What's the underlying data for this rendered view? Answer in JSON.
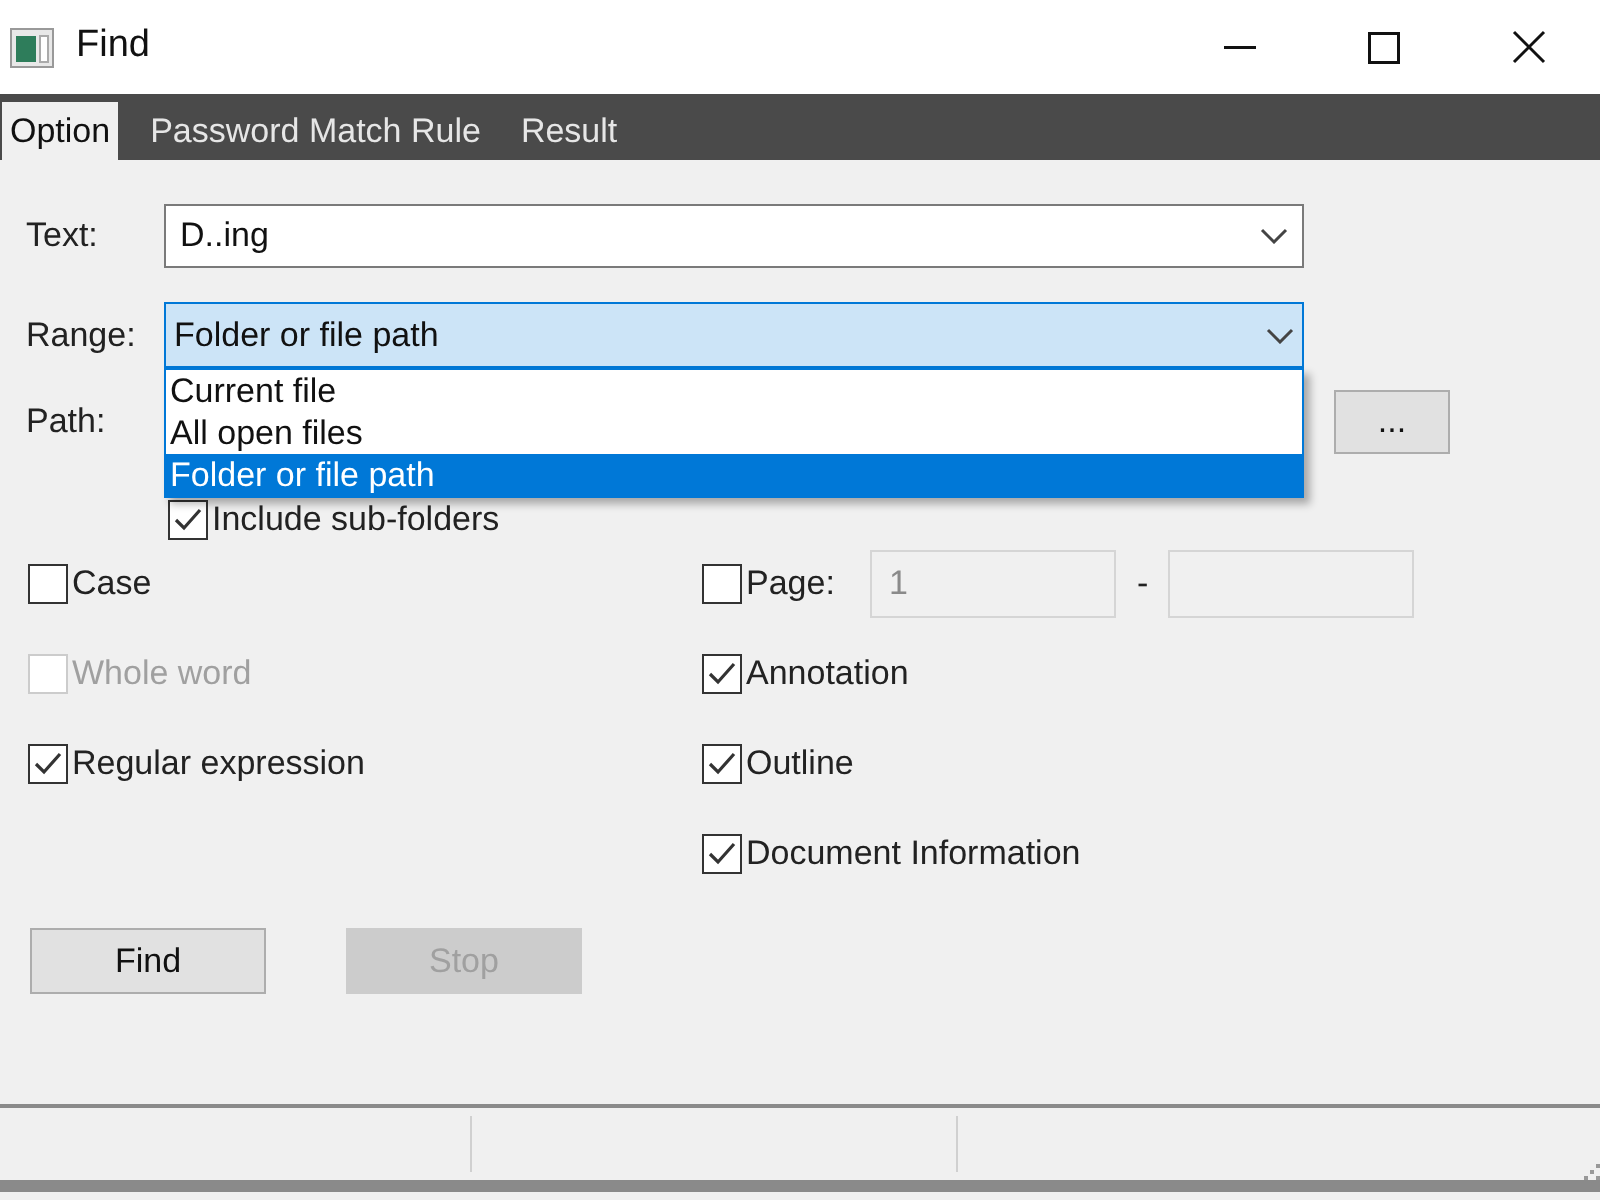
{
  "window": {
    "title": "Find"
  },
  "tabs": [
    {
      "label": "Option",
      "selected": true
    },
    {
      "label": "Password Match Rule",
      "selected": false
    },
    {
      "label": "Result",
      "selected": false
    }
  ],
  "text_field": {
    "label": "Text:",
    "value": "D..ing"
  },
  "range_field": {
    "label": "Range:",
    "value": "Folder or file path",
    "expanded": true,
    "options": [
      {
        "label": "Current file",
        "selected": false
      },
      {
        "label": "All open files",
        "selected": false
      },
      {
        "label": "Folder or file path",
        "selected": true
      }
    ]
  },
  "path": {
    "label": "Path:",
    "browse_button": "..."
  },
  "include_subfolders": {
    "label": "Include sub-folders",
    "checked": true
  },
  "options_left": [
    {
      "label": "Case",
      "checked": false,
      "disabled": false
    },
    {
      "label": "Whole word",
      "checked": false,
      "disabled": true
    },
    {
      "label": "Regular expression",
      "checked": true,
      "disabled": false
    }
  ],
  "page_option": {
    "label": "Page:",
    "checked": false,
    "from": "1",
    "separator": "-"
  },
  "options_right": [
    {
      "label": "Annotation",
      "checked": true,
      "disabled": false
    },
    {
      "label": "Outline",
      "checked": true,
      "disabled": false
    },
    {
      "label": "Document Information",
      "checked": true,
      "disabled": false
    }
  ],
  "buttons": [
    {
      "label": "Find",
      "disabled": false
    },
    {
      "label": "Stop",
      "disabled": true
    }
  ]
}
